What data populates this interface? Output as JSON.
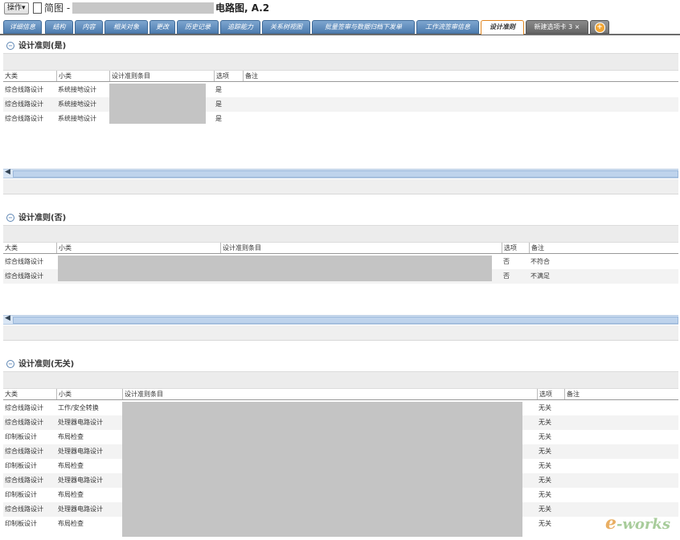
{
  "header": {
    "operation_button": "操作▾",
    "title_prefix": "简图 -",
    "title_suffix": "电路图, A.2"
  },
  "tabs": [
    {
      "label": "详细信息",
      "active": false
    },
    {
      "label": "结构",
      "active": false
    },
    {
      "label": "内容",
      "active": false
    },
    {
      "label": "相关对象",
      "active": false
    },
    {
      "label": "更改",
      "active": false
    },
    {
      "label": "历史记录",
      "active": false
    },
    {
      "label": "追踪能力",
      "active": false
    },
    {
      "label": "关系树视图",
      "active": false
    },
    {
      "label": "批量签审与数据归档下发单",
      "active": false
    },
    {
      "label": "工作流签审信息",
      "active": false
    },
    {
      "label": "设计准则",
      "active": true
    },
    {
      "label": "新建选项卡 3 ×",
      "active": false
    }
  ],
  "section_yes": {
    "title": "设计准则(是)",
    "columns": [
      "大类",
      "小类",
      "设计准则条目",
      "选项",
      "备注"
    ],
    "rows": [
      {
        "cat": "综合线路设计",
        "sub": "系统接地设计",
        "opt": "是",
        "note": ""
      },
      {
        "cat": "综合线路设计",
        "sub": "系统接地设计",
        "opt": "是",
        "note": ""
      },
      {
        "cat": "综合线路设计",
        "sub": "系统接地设计",
        "opt": "是",
        "note": ""
      }
    ]
  },
  "section_no": {
    "title": "设计准则(否)",
    "columns": [
      "大类",
      "小类",
      "设计准则条目",
      "选项",
      "备注"
    ],
    "rows": [
      {
        "cat": "综合线路设计",
        "sub": "",
        "opt": "否",
        "note": "不符合"
      },
      {
        "cat": "综合线路设计",
        "sub": "",
        "opt": "否",
        "note": "不满足"
      }
    ]
  },
  "section_na": {
    "title": "设计准则(无关)",
    "columns": [
      "大类",
      "小类",
      "设计准则条目",
      "选项",
      "备注"
    ],
    "rows": [
      {
        "cat": "综合线路设计",
        "sub": "工作/安全转换",
        "opt": "无关"
      },
      {
        "cat": "综合线路设计",
        "sub": "处理器电路设计",
        "opt": "无关"
      },
      {
        "cat": "印制板设计",
        "sub": "布局检查",
        "opt": "无关"
      },
      {
        "cat": "综合线路设计",
        "sub": "处理器电路设计",
        "opt": "无关"
      },
      {
        "cat": "印制板设计",
        "sub": "布局检查",
        "opt": "无关"
      },
      {
        "cat": "综合线路设计",
        "sub": "处理器电路设计",
        "opt": "无关"
      },
      {
        "cat": "印制板设计",
        "sub": "布局检查",
        "opt": "无关"
      },
      {
        "cat": "综合线路设计",
        "sub": "处理器电路设计",
        "opt": "无关"
      },
      {
        "cat": "印制板设计",
        "sub": "布局检查",
        "opt": "无关"
      }
    ]
  },
  "watermark": {
    "e": "e",
    "rest": "-works"
  }
}
